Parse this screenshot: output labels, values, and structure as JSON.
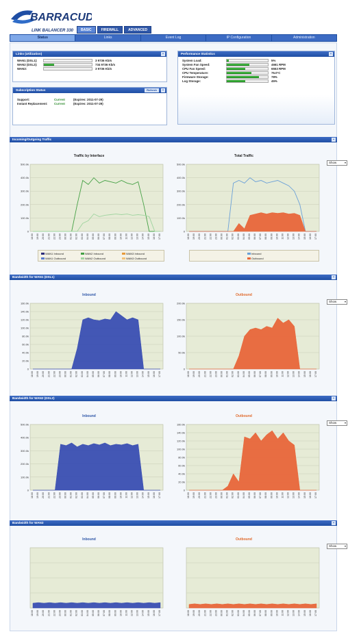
{
  "brand": {
    "name": "BARRACUDA",
    "subtitle": "LINK BALANCER 330"
  },
  "top_tabs": [
    {
      "label": "BASIC",
      "active": true
    },
    {
      "label": "FIREWALL",
      "active": false
    },
    {
      "label": "ADVANCED",
      "active": false
    }
  ],
  "nav": [
    {
      "label": "Status",
      "active": true
    },
    {
      "label": "Links",
      "active": false
    },
    {
      "label": "Event Log",
      "active": false
    },
    {
      "label": "IP Configuration",
      "active": false
    },
    {
      "label": "Administration",
      "active": false
    }
  ],
  "links": {
    "title": "Links (Utilization)",
    "rows": [
      {
        "label": "WAN1 (DSL1):",
        "value": "3 9736 Kb/s",
        "fill": 0.0
      },
      {
        "label": "WAN2 (DSL2):",
        "value": "734 9736 Kb/s",
        "fill": 0.22
      },
      {
        "label": "WAN3:",
        "value": "3 9736 Kb/s",
        "fill": 0.0
      }
    ]
  },
  "subscription": {
    "title": "Subscription Status",
    "button": "Refresh",
    "rows": [
      {
        "label": "Support:",
        "status": "Current",
        "detail": "(Expires: 2011-07-29)"
      },
      {
        "label": "Instant Replacement:",
        "status": "Current",
        "detail": "(Expires: 2011-07-29)"
      }
    ]
  },
  "performance": {
    "title": "Performance Statistics",
    "rows": [
      {
        "label": "System Load:",
        "value": "5%",
        "fill": 0.05
      },
      {
        "label": "System Fan Speed:",
        "value": "4661 RPM",
        "fill": 0.55
      },
      {
        "label": "CPU Fan Speed:",
        "value": "6553 RPM",
        "fill": 0.45
      },
      {
        "label": "CPU Temperature:",
        "value": "76.0°C",
        "fill": 0.6
      },
      {
        "label": "Firmware Storage:",
        "value": "78%",
        "fill": 0.78
      },
      {
        "label": "Log Storage:",
        "value": "45%",
        "fill": 0.45
      }
    ]
  },
  "sections": [
    {
      "title": "Incoming/Outgoing Traffic",
      "select": "Show",
      "left_title": "Traffic by Interface",
      "right_title": "Total Traffic",
      "left_legend": [
        "WAN1 Inbound",
        "WAN2 Inbound",
        "WAN3 Inbound",
        "WAN1 Outbound",
        "WAN2 Outbound",
        "WAN3 Outbound"
      ],
      "right_legend": [
        "Inbound",
        "Outbound"
      ]
    },
    {
      "title": "Bandwidth for WAN1 (DSL1)",
      "select": "Show",
      "left_title": "Inbound",
      "right_title": "Outbound"
    },
    {
      "title": "Bandwidth for WAN2 (DSL2)",
      "select": "Show",
      "left_title": "Inbound",
      "right_title": "Outbound"
    },
    {
      "title": "Bandwidth for WAN3",
      "select": "Show",
      "left_title": "Inbound",
      "right_title": "Outbound"
    }
  ],
  "colors": {
    "inbound": "#3a4fb3",
    "outbound": "#e8663a",
    "wan1": "#2d2d7a",
    "wan2": "#44a044",
    "wan3": "#e69a3a",
    "total_in": "#6aa0d8"
  },
  "chart_data": [
    {
      "type": "line",
      "title": "Traffic by Interface",
      "yticks": [
        "500.0k",
        "400.0k",
        "300.0k",
        "200.0k",
        "100.0k",
        "0"
      ],
      "ylim": [
        0,
        500
      ],
      "x": [
        0,
        1,
        2,
        3,
        4,
        5,
        6,
        7,
        8,
        9,
        10,
        11,
        12,
        13,
        14,
        15,
        16,
        17,
        18,
        19,
        20,
        21,
        22,
        23
      ],
      "series": [
        {
          "name": "WAN2 Inbound",
          "values": [
            0,
            0,
            0,
            0,
            0,
            0,
            0,
            0,
            200,
            380,
            350,
            400,
            360,
            380,
            370,
            360,
            380,
            360,
            350,
            370,
            200,
            0,
            0,
            0
          ]
        },
        {
          "name": "WAN2 Outbound",
          "values": [
            0,
            0,
            0,
            0,
            0,
            0,
            0,
            0,
            0,
            60,
            80,
            130,
            110,
            120,
            125,
            130,
            125,
            130,
            120,
            125,
            120,
            110,
            0,
            0
          ]
        }
      ],
      "grid": true
    },
    {
      "type": "area",
      "title": "Total Traffic",
      "yticks": [
        "500.0k",
        "400.0k",
        "300.0k",
        "200.0k",
        "100.0k",
        "0"
      ],
      "ylim": [
        0,
        500
      ],
      "x": [
        0,
        1,
        2,
        3,
        4,
        5,
        6,
        7,
        8,
        9,
        10,
        11,
        12,
        13,
        14,
        15,
        16,
        17,
        18,
        19,
        20,
        21,
        22,
        23
      ],
      "series": [
        {
          "name": "Inbound",
          "values": [
            0,
            0,
            0,
            0,
            0,
            0,
            0,
            0,
            360,
            380,
            360,
            400,
            370,
            380,
            360,
            370,
            380,
            360,
            340,
            300,
            200,
            0,
            0,
            0
          ]
        },
        {
          "name": "Outbound",
          "values": [
            0,
            0,
            0,
            0,
            0,
            0,
            0,
            0,
            0,
            60,
            20,
            120,
            130,
            140,
            130,
            140,
            135,
            140,
            130,
            135,
            120,
            0,
            0,
            0
          ]
        }
      ],
      "grid": true
    },
    {
      "type": "area",
      "title": "Inbound",
      "yticks": [
        "160.0k",
        "140.0k",
        "120.0k",
        "100.0k",
        "80.0k",
        "60.0k",
        "40.0k",
        "20.0k",
        "0"
      ],
      "ylim": [
        0,
        160
      ],
      "x": [
        0,
        1,
        2,
        3,
        4,
        5,
        6,
        7,
        8,
        9,
        10,
        11,
        12,
        13,
        14,
        15,
        16,
        17,
        18,
        19,
        20,
        21,
        22,
        23
      ],
      "series": [
        {
          "name": "Inbound",
          "values": [
            0,
            0,
            0,
            0,
            0,
            0,
            0,
            0,
            50,
            120,
            125,
            120,
            118,
            122,
            120,
            140,
            130,
            120,
            125,
            120,
            0,
            0,
            0,
            0
          ]
        }
      ],
      "grid": true
    },
    {
      "type": "area",
      "title": "Outbound",
      "yticks": [
        "200.0k",
        "150.0k",
        "100.0k",
        "50.0k",
        "0"
      ],
      "ylim": [
        0,
        200
      ],
      "x": [
        0,
        1,
        2,
        3,
        4,
        5,
        6,
        7,
        8,
        9,
        10,
        11,
        12,
        13,
        14,
        15,
        16,
        17,
        18,
        19,
        20,
        21,
        22,
        23
      ],
      "series": [
        {
          "name": "Outbound",
          "values": [
            0,
            0,
            0,
            0,
            0,
            0,
            0,
            0,
            0,
            40,
            100,
            120,
            125,
            120,
            130,
            125,
            155,
            140,
            150,
            130,
            0,
            0,
            0,
            0
          ]
        }
      ],
      "grid": true
    },
    {
      "type": "area",
      "title": "Inbound",
      "yticks": [
        "500.0k",
        "400.0k",
        "300.0k",
        "200.0k",
        "100.0k",
        "0"
      ],
      "ylim": [
        0,
        500
      ],
      "x": [
        0,
        1,
        2,
        3,
        4,
        5,
        6,
        7,
        8,
        9,
        10,
        11,
        12,
        13,
        14,
        15,
        16,
        17,
        18,
        19,
        20,
        21,
        22,
        23
      ],
      "series": [
        {
          "name": "Inbound",
          "values": [
            0,
            0,
            0,
            0,
            0,
            350,
            340,
            360,
            330,
            350,
            340,
            355,
            345,
            360,
            340,
            350,
            345,
            355,
            340,
            350,
            0,
            0,
            0,
            0
          ]
        }
      ],
      "grid": true
    },
    {
      "type": "area",
      "title": "Outbound",
      "yticks": [
        "160.0k",
        "140.0k",
        "120.0k",
        "100.0k",
        "80.0k",
        "60.0k",
        "40.0k",
        "20.0k",
        "0"
      ],
      "ylim": [
        0,
        160
      ],
      "x": [
        0,
        1,
        2,
        3,
        4,
        5,
        6,
        7,
        8,
        9,
        10,
        11,
        12,
        13,
        14,
        15,
        16,
        17,
        18,
        19,
        20,
        21,
        22,
        23
      ],
      "series": [
        {
          "name": "Outbound",
          "values": [
            0,
            0,
            0,
            0,
            0,
            0,
            0,
            10,
            40,
            20,
            130,
            125,
            140,
            120,
            135,
            145,
            125,
            140,
            120,
            110,
            0,
            0,
            0,
            0
          ]
        }
      ],
      "grid": true
    },
    {
      "type": "area",
      "title": "Inbound",
      "ylim": [
        0,
        100
      ],
      "x": [
        0,
        1,
        2,
        3,
        4,
        5,
        6,
        7,
        8,
        9,
        10,
        11,
        12,
        13,
        14,
        15,
        16,
        17,
        18,
        19,
        20,
        21,
        22,
        23
      ],
      "series": [
        {
          "name": "Inbound",
          "values": [
            8,
            9,
            8,
            9,
            8,
            9,
            8,
            9,
            8,
            9,
            8,
            9,
            8,
            9,
            8,
            9,
            8,
            9,
            8,
            9,
            8,
            9,
            8,
            9
          ]
        }
      ],
      "grid": true
    },
    {
      "type": "area",
      "title": "Outbound",
      "ylim": [
        0,
        100
      ],
      "x": [
        0,
        1,
        2,
        3,
        4,
        5,
        6,
        7,
        8,
        9,
        10,
        11,
        12,
        13,
        14,
        15,
        16,
        17,
        18,
        19,
        20,
        21,
        22,
        23
      ],
      "series": [
        {
          "name": "Outbound",
          "values": [
            6,
            7,
            6,
            7,
            6,
            7,
            6,
            7,
            6,
            7,
            6,
            7,
            6,
            7,
            6,
            7,
            6,
            7,
            6,
            7,
            6,
            7,
            6,
            7
          ]
        }
      ],
      "grid": true
    }
  ]
}
